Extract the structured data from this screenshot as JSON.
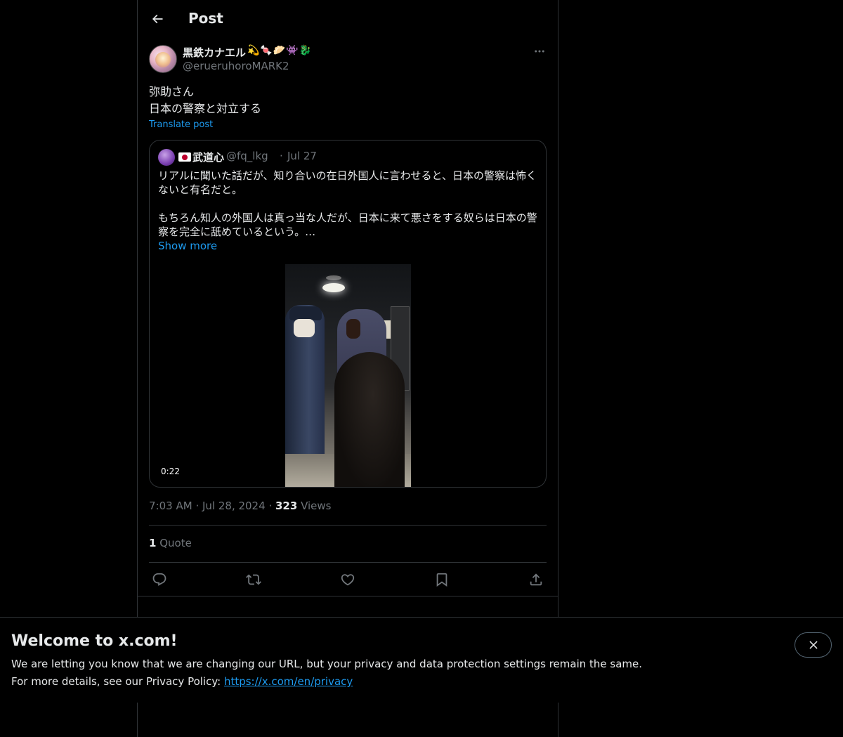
{
  "header": {
    "title": "Post"
  },
  "post": {
    "author_name": "黒鉄カナエル",
    "author_emojis": "💫🍬🥟👾🐉",
    "author_handle": "@erueruhoroMARK2",
    "text_line1": "弥助さん",
    "text_line2": "日本の警察と対立する",
    "translate_label": "Translate post",
    "time": "7:03 AM",
    "date": "Jul 28, 2024",
    "views_count": "323",
    "views_label": "Views",
    "quotes_count": "1",
    "quotes_label": "Quote"
  },
  "quoted": {
    "name": "武道心",
    "handle": "@fq_lkg",
    "separator": "·",
    "date": "Jul 27",
    "text": "リアルに聞いた話だが、知り合いの在日外国人に言わせると、日本の警察は怖く\nないと有名だと。\n\nもちろん知人の外国人は真っ当な人だが、日本に来て悪さをする奴らは日本の警\n察を完全に舐めているという。…",
    "show_more": "Show more",
    "video_duration": "0:22"
  },
  "banner": {
    "title": "Welcome to x.com!",
    "line1": "We are letting you know that we are changing our URL, but your privacy and data protection settings remain the same.",
    "line2_prefix": "For more details, see our Privacy Policy: ",
    "link": "https://x.com/en/privacy"
  },
  "colors": {
    "accent": "#1d9bf0",
    "muted": "#71767b",
    "border": "#2f3336",
    "background": "#000000"
  },
  "icons": [
    "back-arrow-icon",
    "more-icon",
    "reply-icon",
    "repost-icon",
    "like-icon",
    "bookmark-icon",
    "share-icon",
    "close-icon"
  ]
}
